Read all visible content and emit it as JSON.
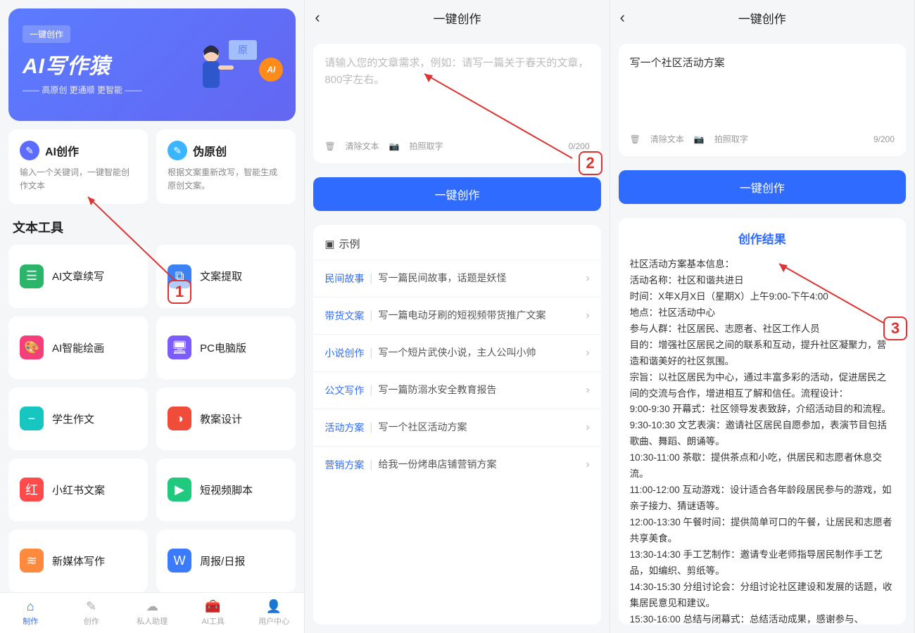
{
  "s1": {
    "hero_badge": "一键创作",
    "hero_title": "AI写作猿",
    "hero_sub": "—— 高原创 更通顺 更智能 ——",
    "ai_label": "AI",
    "cards": [
      {
        "title": "AI创作",
        "desc": "输入一个关键词，一键智能创作文本"
      },
      {
        "title": "伪原创",
        "desc": "根据文案重新改写，智能生成原创文案。"
      }
    ],
    "section": "文本工具",
    "tools": [
      {
        "name": "AI文章续写",
        "color": "#2ab56b",
        "glyph": "☰"
      },
      {
        "name": "文案提取",
        "color": "#3b82f6",
        "glyph": "⧉"
      },
      {
        "name": "AI智能绘画",
        "color": "#f43f7a",
        "glyph": "🎨"
      },
      {
        "name": "PC电脑版",
        "color": "#7c5cff",
        "glyph": "🖥"
      },
      {
        "name": "学生作文",
        "color": "#17c6c0",
        "glyph": "−"
      },
      {
        "name": "教案设计",
        "color": "#ef4d3a",
        "glyph": "◑"
      },
      {
        "name": "小红书文案",
        "color": "#ff4b4b",
        "glyph": "红"
      },
      {
        "name": "短视频脚本",
        "color": "#1fc97e",
        "glyph": "▶"
      },
      {
        "name": "新媒体写作",
        "color": "#ff8a3d",
        "glyph": "≋"
      },
      {
        "name": "周报/日报",
        "color": "#3b7bff",
        "glyph": "W"
      }
    ],
    "tabs": [
      {
        "label": "制作",
        "glyph": "⌂"
      },
      {
        "label": "创作",
        "glyph": "✎"
      },
      {
        "label": "私人助理",
        "glyph": "☁"
      },
      {
        "label": "AI工具",
        "glyph": "🧰"
      },
      {
        "label": "用户中心",
        "glyph": "👤"
      }
    ]
  },
  "s2": {
    "title": "一键创作",
    "placeholder": "请输入您的文章需求，例如：请写一篇关于春天的文章，800字左右。",
    "clear": "清除文本",
    "camera": "拍照取字",
    "count": "0/200",
    "btn": "一键创作",
    "ex_head": "示例",
    "examples": [
      {
        "tag": "民间故事",
        "text": "写一篇民间故事，话题是妖怪"
      },
      {
        "tag": "带货文案",
        "text": "写一篇电动牙刷的短视频带货推广文案"
      },
      {
        "tag": "小说创作",
        "text": "写一个短片武侠小说，主人公叫小帅"
      },
      {
        "tag": "公文写作",
        "text": "写一篇防溺水安全教育报告"
      },
      {
        "tag": "活动方案",
        "text": "写一个社区活动方案"
      },
      {
        "tag": "营销方案",
        "text": "给我一份烤串店铺营销方案"
      }
    ]
  },
  "s3": {
    "title": "一键创作",
    "input": "写一个社区活动方案",
    "clear": "清除文本",
    "camera": "拍照取字",
    "count": "9/200",
    "btn": "一键创作",
    "result_title": "创作结果",
    "result_body": "社区活动方案基本信息：\n活动名称：社区和谐共进日\n时间：X年X月X日（星期X）上午9:00-下午4:00\n地点：社区活动中心\n参与人群：社区居民、志愿者、社区工作人员\n目的：增强社区居民之间的联系和互动，提升社区凝聚力，营造和谐美好的社区氛围。\n宗旨：以社区居民为中心，通过丰富多彩的活动，促进居民之间的交流与合作，增进相互了解和信任。流程设计：\n9:00-9:30 开幕式：社区领导发表致辞，介绍活动目的和流程。\n9:30-10:30 文艺表演：邀请社区居民自愿参加，表演节目包括歌曲、舞蹈、朗诵等。\n10:30-11:00 茶歇：提供茶点和小吃，供居民和志愿者休息交流。\n11:00-12:00 互动游戏：设计适合各年龄段居民参与的游戏，如亲子接力、猜谜语等。\n12:00-13:30 午餐时间：提供简单可口的午餐，让居民和志愿者共享美食。\n13:30-14:30 手工艺制作：邀请专业老师指导居民制作手工艺品，如编织、剪纸等。\n14:30-15:30 分组讨论会：分组讨论社区建设和发展的话题，收集居民意见和建议。\n15:30-16:00 总结与闭幕式：总结活动成果，感谢参与、"
  },
  "callouts": {
    "c1": "1",
    "c2": "2",
    "c3": "3"
  }
}
